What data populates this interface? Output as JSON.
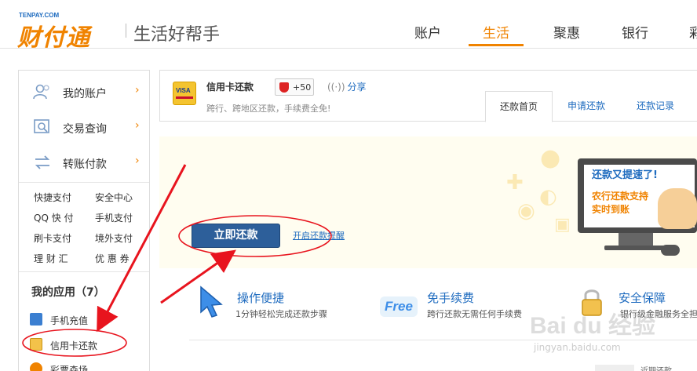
{
  "header": {
    "logo_small": "TENPAY.COM",
    "logo_main": "财付通",
    "slogan": "生活好帮手",
    "nav": [
      "账户",
      "生活",
      "聚惠",
      "银行",
      "彩"
    ],
    "active_nav": "生活",
    "accent": "#f08300"
  },
  "sidebar": {
    "main_items": [
      {
        "label": "我的账户",
        "icon": "user-icon"
      },
      {
        "label": "交易查询",
        "icon": "search-document-icon"
      },
      {
        "label": "转账付款",
        "icon": "transfer-icon"
      }
    ],
    "chevron": "›",
    "links": [
      "快捷支付",
      "安全中心",
      "QQ 快 付",
      "手机支付",
      "刷卡支付",
      "境外支付",
      "理 财 汇",
      "优 惠 券"
    ],
    "apps_title": "我的应用（7）",
    "apps": [
      {
        "label": "手机充值",
        "icon": "phone-recharge-icon"
      },
      {
        "label": "信用卡还款",
        "icon": "credit-card-icon"
      },
      {
        "label": "彩票森场",
        "icon": "lottery-icon"
      }
    ]
  },
  "service": {
    "card_brand": "VISA",
    "title": "信用卡还款",
    "subtitle": "跨行、跨地区还款，手续费全免!",
    "points": "+50",
    "share": "分享",
    "tabs": [
      "还款首页",
      "申请还款",
      "还款记录"
    ],
    "active_tab": "还款首页"
  },
  "banner": {
    "pay_button": "立即还款",
    "remind_link": "开启还款提醒",
    "monitor_line1": "还款又提速了!",
    "monitor_line2": "农行还款支持",
    "monitor_line3": "实时到账"
  },
  "features": [
    {
      "title": "操作便捷",
      "desc": "1分钟轻松完成还款步骤",
      "icon": "cursor-icon"
    },
    {
      "title": "免手续费",
      "desc": "跨行还款无需任何手续费",
      "icon": "free-badge-icon",
      "badge": "Free"
    },
    {
      "title": "安全保障",
      "desc": "银行级金融服务全担",
      "icon": "lock-icon"
    }
  ],
  "watermark": {
    "main": "Bai du 经验",
    "sub": "jingyan.baidu.com"
  },
  "bottom_peek": "近期还款"
}
